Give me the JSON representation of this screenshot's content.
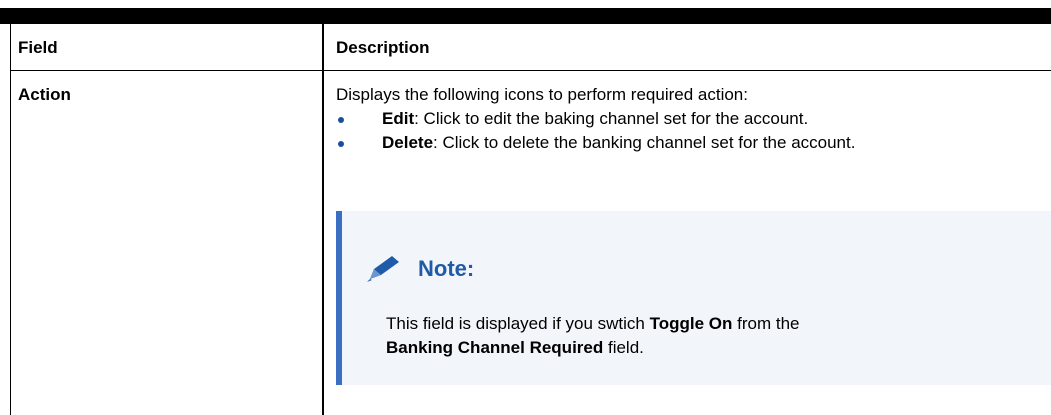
{
  "table": {
    "headers": {
      "field": "Field",
      "description": "Description"
    },
    "row": {
      "field": "Action",
      "intro": "Displays the following icons to perform required action:",
      "bullets": [
        {
          "term": "Edit",
          "text": ": Click to edit the baking channel set for the account."
        },
        {
          "term": "Delete",
          "text": ": Click to delete the banking channel set for the account."
        }
      ],
      "note": {
        "label": "Note:",
        "icon": "pencil-icon",
        "text_1": "This field is displayed if you swtich ",
        "bold_1": "Toggle On",
        "text_2": " from the ",
        "bold_2": "Banking Channel Required",
        "text_3": " field."
      }
    }
  },
  "colors": {
    "bullet": "#1a4fa0",
    "note_border": "#3a6fc3",
    "note_background": "#f2f6fb",
    "note_label": "#1f5ba8"
  }
}
